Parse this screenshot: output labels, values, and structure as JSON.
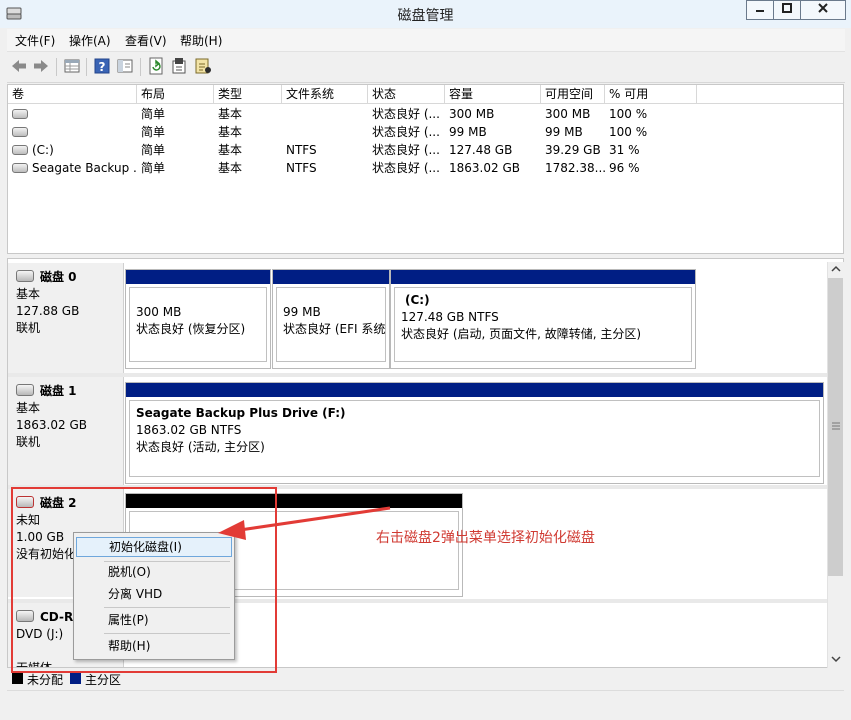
{
  "window": {
    "title": "磁盘管理"
  },
  "menu": [
    "文件(F)",
    "操作(A)",
    "查看(V)",
    "帮助(H)"
  ],
  "toolbar": [
    "back-arrow-icon",
    "forward-arrow-icon",
    "properties-grid-icon",
    "help-icon",
    "pane-view-icon",
    "refresh-icon",
    "settings-icon",
    "disk-check-icon"
  ],
  "volume_list": {
    "columns": [
      "卷",
      "布局",
      "类型",
      "文件系统",
      "状态",
      "容量",
      "可用空间",
      "% 可用"
    ],
    "rows": [
      [
        "",
        "简单",
        "基本",
        "",
        "状态良好 (...",
        "300 MB",
        "300 MB",
        "100 %"
      ],
      [
        "",
        "简单",
        "基本",
        "",
        "状态良好 (...",
        "99 MB",
        "99 MB",
        "100 %"
      ],
      [
        "(C:)",
        "简单",
        "基本",
        "NTFS",
        "状态良好 (...",
        "127.48 GB",
        "39.29 GB",
        "31 %"
      ],
      [
        "Seagate Backup ...",
        "简单",
        "基本",
        "NTFS",
        "状态良好 (...",
        "1863.02 GB",
        "1782.38...",
        "96 %"
      ]
    ]
  },
  "disks": [
    {
      "name": "磁盘 0",
      "type": "基本",
      "size": "127.88 GB",
      "state": "联机",
      "partitions": [
        {
          "title": "",
          "size": "300 MB",
          "status": "状态良好 (恢复分区)"
        },
        {
          "title": "",
          "size": "99 MB",
          "status": "状态良好 (EFI 系统"
        },
        {
          "title": "(C:)",
          "size": "127.48 GB NTFS",
          "status": "状态良好 (启动, 页面文件, 故障转储, 主分区)"
        }
      ]
    },
    {
      "name": "磁盘 1",
      "type": "基本",
      "size": "1863.02 GB",
      "state": "联机",
      "partitions": [
        {
          "title": "Seagate Backup Plus Drive  (F:)",
          "size": "1863.02 GB NTFS",
          "status": "状态良好 (活动, 主分区)"
        }
      ]
    },
    {
      "name": "磁盘 2",
      "type": "未知",
      "size": "1.00 GB",
      "state": "没有初始化"
    },
    {
      "name": "CD-ROM 0",
      "type": "DVD (J:)",
      "size": "",
      "state": "无媒体"
    }
  ],
  "context_menu": {
    "items": [
      "初始化磁盘(I)",
      "脱机(O)",
      "分离 VHD",
      "属性(P)",
      "帮助(H)"
    ],
    "highlighted": 0
  },
  "legend": [
    {
      "label": "未分配",
      "color": "#000000"
    },
    {
      "label": "主分区",
      "color": "#001e84"
    }
  ],
  "annotation": {
    "text": "右击磁盘2弹出菜单选择初始化磁盘",
    "color": "#e23b36"
  }
}
